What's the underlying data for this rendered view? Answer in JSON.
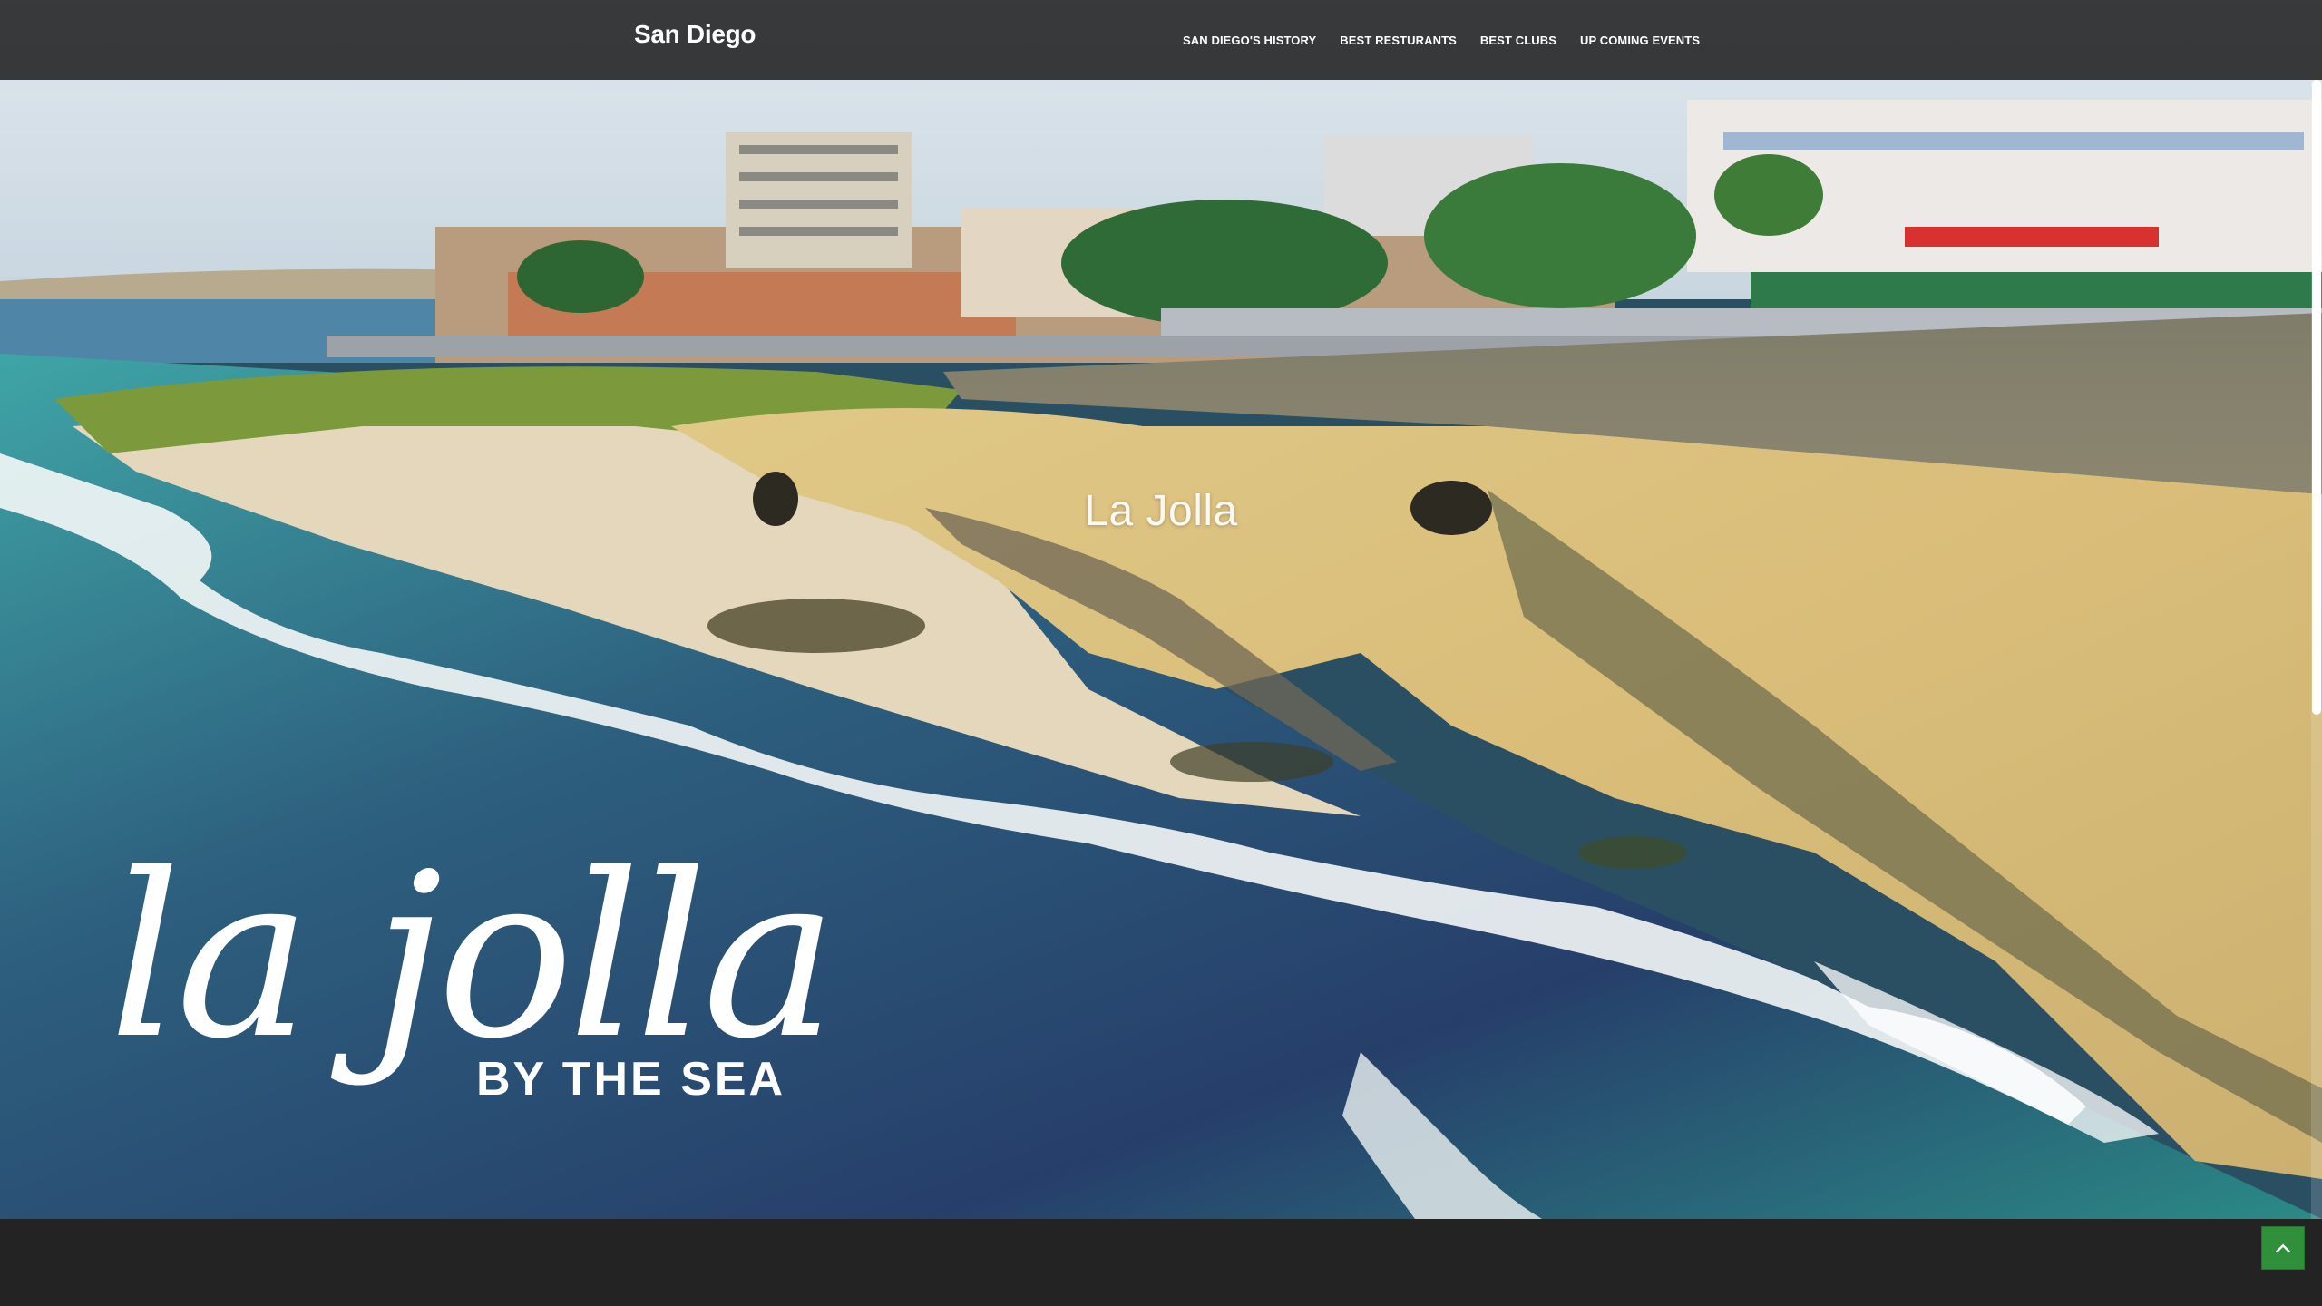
{
  "site": {
    "brand": "San Diego"
  },
  "nav": {
    "items": [
      {
        "label": "SAN DIEGO'S HISTORY"
      },
      {
        "label": "BEST RESTURANTS"
      },
      {
        "label": "BEST CLUBS"
      },
      {
        "label": "UP COMING EVENTS"
      }
    ]
  },
  "hero": {
    "caption": "La Jolla",
    "logo_script": "la jolla",
    "logo_tagline": "BY THE SEA"
  },
  "controls": {
    "back_to_top_icon": "chevron-up-icon"
  },
  "colors": {
    "navbar": "#1c1c1c",
    "accent": "#2f8f3a",
    "footer": "#232323"
  }
}
